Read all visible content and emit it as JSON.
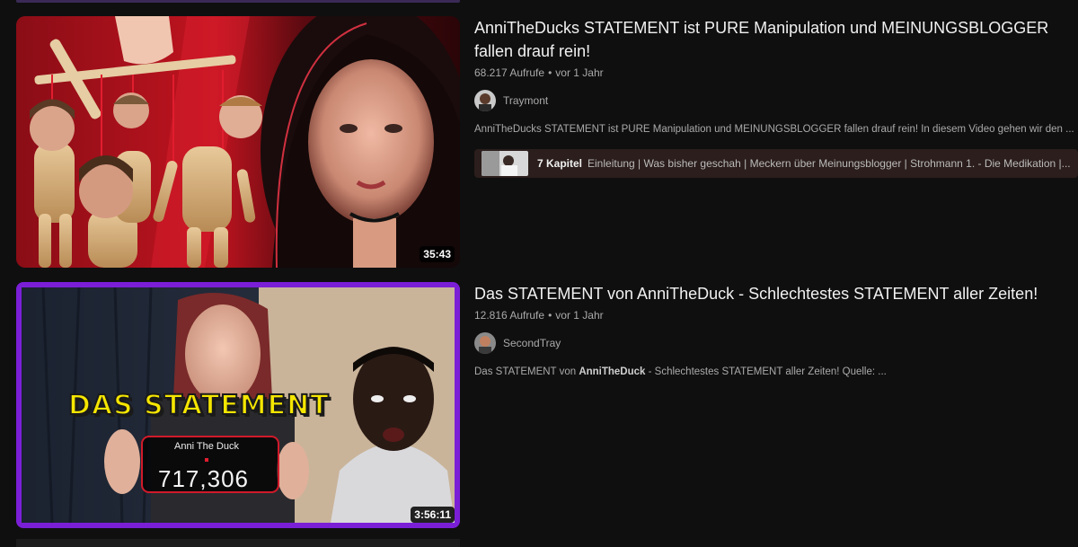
{
  "results": [
    {
      "title": "AnniTheDucks STATEMENT ist PURE Manipulation und MEINUNGSBLOGGER fallen drauf rein!",
      "views": "68.217 Aufrufe",
      "age": "vor 1 Jahr",
      "channel": "Traymont",
      "description": "AnniTheDucks STATEMENT ist PURE Manipulation und MEINUNGSBLOGGER fallen drauf rein! In diesem Video gehen wir den ...",
      "duration": "35:43",
      "chapters_count": "7 Kapitel",
      "chapters_list": "Einleitung | Was bisher geschah | Meckern über Meinungsblogger | Strohmann 1. - Die Medikation |..."
    },
    {
      "title": "Das STATEMENT von AnniTheDuck - Schlechtestes STATEMENT aller Zeiten!",
      "views": "12.816 Aufrufe",
      "age": "vor 1 Jahr",
      "channel": "SecondTray",
      "description_pre": "Das STATEMENT von ",
      "description_bold": "AnniTheDuck",
      "description_post": " - Schlechtestes STATEMENT aller Zeiten! Quelle: ...",
      "duration": "3:56:11",
      "thumb_banner": "DAS STATEMENT",
      "thumb_counter_label": "Anni The Duck",
      "thumb_counter_value": "717,306"
    }
  ],
  "dot": "•",
  "colors": {
    "background": "#0f0f0f",
    "title": "#f1f1f1",
    "meta": "#aaaaaa",
    "chapters_bg": "#2b1e1c",
    "thumb2_border": "#7a1fd6",
    "banner_yellow": "#f5e600"
  }
}
